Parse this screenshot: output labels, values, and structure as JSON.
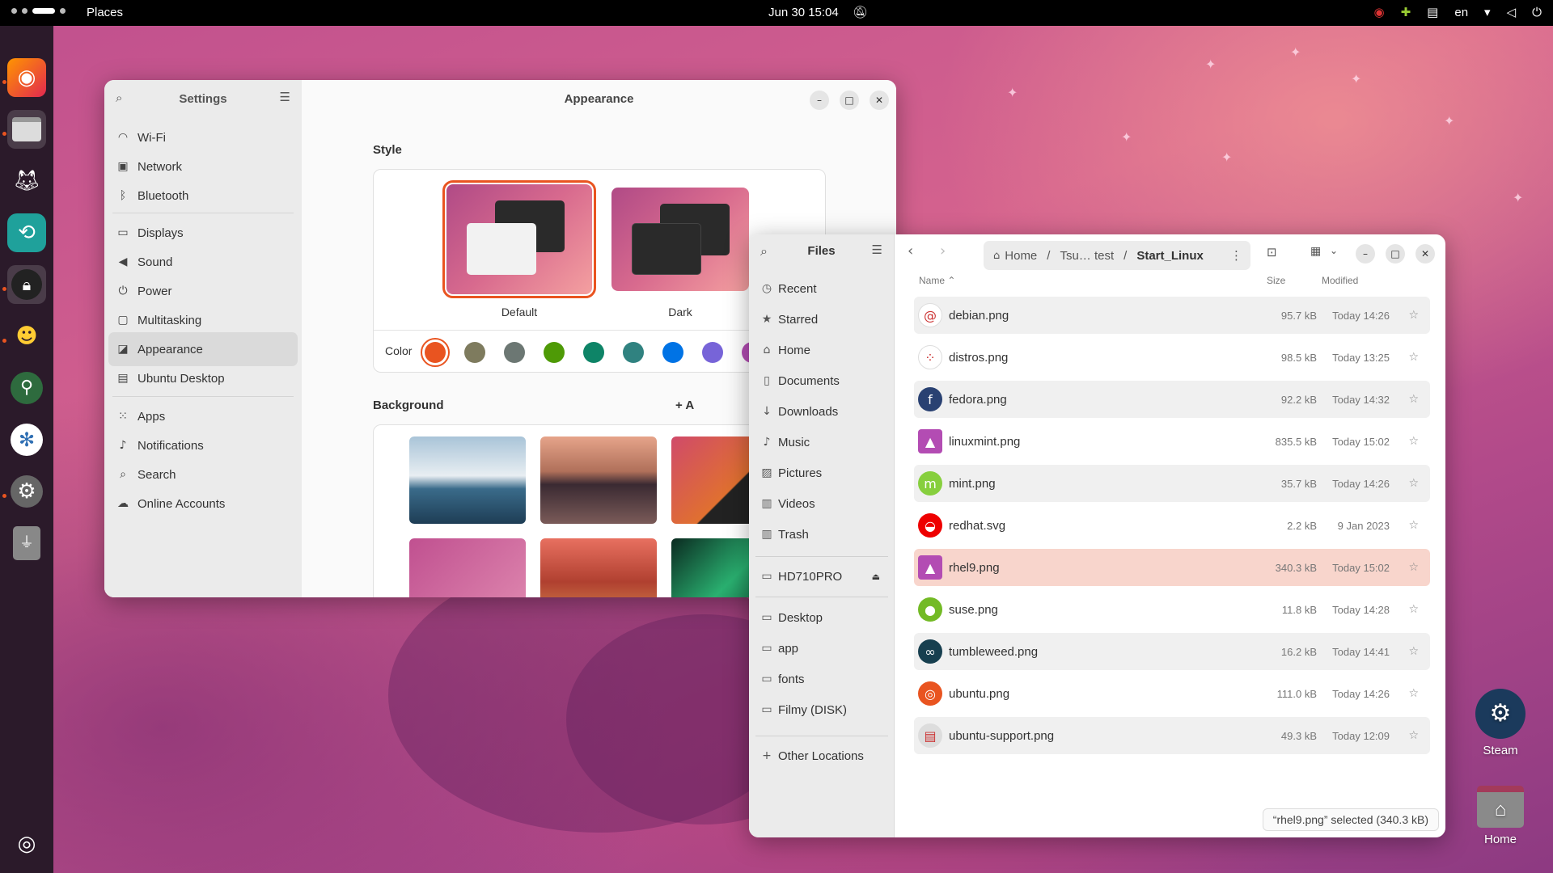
{
  "topbar": {
    "activity": "Places",
    "clock": "Jun 30  15:04",
    "lang": "en"
  },
  "dock": {
    "apps": [
      "firefox-icon",
      "files-icon",
      "gimp-icon",
      "app-green-icon",
      "lock-app-icon",
      "figure-app-icon",
      "inkscape-icon",
      "vscode-icon",
      "settings-icon",
      "usb-icon"
    ],
    "show_apps": "ubuntu-logo-icon"
  },
  "settings": {
    "sidebar_title": "Settings",
    "items": [
      {
        "label": "Wi-Fi",
        "icon": "wifi-icon"
      },
      {
        "label": "Network",
        "icon": "network-icon"
      },
      {
        "label": "Bluetooth",
        "icon": "bluetooth-icon"
      },
      {
        "label": "Displays",
        "icon": "display-icon"
      },
      {
        "label": "Sound",
        "icon": "sound-icon"
      },
      {
        "label": "Power",
        "icon": "power-icon"
      },
      {
        "label": "Multitasking",
        "icon": "multitasking-icon"
      },
      {
        "label": "Appearance",
        "icon": "appearance-icon"
      },
      {
        "label": "Ubuntu Desktop",
        "icon": "ubuntu-desktop-icon"
      },
      {
        "label": "Apps",
        "icon": "apps-icon"
      },
      {
        "label": "Notifications",
        "icon": "bell-icon"
      },
      {
        "label": "Search",
        "icon": "search-icon"
      },
      {
        "label": "Online Accounts",
        "icon": "cloud-icon"
      }
    ],
    "selected": "Appearance",
    "title": "Appearance",
    "style_heading": "Style",
    "style_default": "Default",
    "style_dark": "Dark",
    "color_label": "Color",
    "colors": [
      "#e95420",
      "#7e7b5e",
      "#6c7773",
      "#4e9a06",
      "#0e8467",
      "#308280",
      "#0073e5",
      "#7764d8",
      "#b34cb3"
    ],
    "background_heading": "Background",
    "add_picture": "+ A"
  },
  "files": {
    "sidebar_title": "Files",
    "places": [
      {
        "label": "Recent",
        "icon": "clock-icon"
      },
      {
        "label": "Starred",
        "icon": "star-icon"
      },
      {
        "label": "Home",
        "icon": "home-icon"
      },
      {
        "label": "Documents",
        "icon": "document-icon"
      },
      {
        "label": "Downloads",
        "icon": "download-icon"
      },
      {
        "label": "Music",
        "icon": "music-icon"
      },
      {
        "label": "Pictures",
        "icon": "picture-icon"
      },
      {
        "label": "Videos",
        "icon": "video-icon"
      },
      {
        "label": "Trash",
        "icon": "trash-icon"
      }
    ],
    "device": "HD710PRO",
    "bookmarks": [
      "Desktop",
      "app",
      "fonts",
      "Filmy (DISK)"
    ],
    "other": "Other Locations",
    "path": {
      "home": "Home",
      "middle": "Tsu… test",
      "current": "Start_Linux"
    },
    "columns": {
      "name": "Name",
      "size": "Size",
      "modified": "Modified"
    },
    "rows": [
      {
        "name": "debian.png",
        "size": "95.7 kB",
        "modified": "Today 14:26",
        "icon": "debian-icon",
        "color": "#ffffff"
      },
      {
        "name": "distros.png",
        "size": "98.5 kB",
        "modified": "Today 13:25",
        "icon": "distros-icon",
        "color": "#ffffff"
      },
      {
        "name": "fedora.png",
        "size": "92.2 kB",
        "modified": "Today 14:32",
        "icon": "fedora-icon",
        "color": "#294172"
      },
      {
        "name": "linuxmint.png",
        "size": "835.5 kB",
        "modified": "Today 15:02",
        "icon": "image-icon",
        "color": "#b34cb3"
      },
      {
        "name": "mint.png",
        "size": "35.7 kB",
        "modified": "Today 14:26",
        "icon": "mint-icon",
        "color": "#87cf3e"
      },
      {
        "name": "redhat.svg",
        "size": "2.2 kB",
        "modified": "9 Jan 2023",
        "icon": "redhat-icon",
        "color": "#ee0000"
      },
      {
        "name": "rhel9.png",
        "size": "340.3 kB",
        "modified": "Today 15:02",
        "icon": "image-icon",
        "color": "#b34cb3"
      },
      {
        "name": "suse.png",
        "size": "11.8 kB",
        "modified": "Today 14:28",
        "icon": "suse-icon",
        "color": "#73ba25"
      },
      {
        "name": "tumbleweed.png",
        "size": "16.2 kB",
        "modified": "Today 14:41",
        "icon": "tumbleweed-icon",
        "color": "#173f4f"
      },
      {
        "name": "ubuntu.png",
        "size": "111.0 kB",
        "modified": "Today 14:26",
        "icon": "ubuntu-icon",
        "color": "#e95420"
      },
      {
        "name": "ubuntu-support.png",
        "size": "49.3 kB",
        "modified": "Today 12:09",
        "icon": "support-icon",
        "color": "#dddddd"
      }
    ],
    "selected_row": "rhel9.png",
    "status": "“rhel9.png” selected  (340.3 kB)"
  },
  "desktop_icons": {
    "steam": "Steam",
    "home": "Home"
  }
}
